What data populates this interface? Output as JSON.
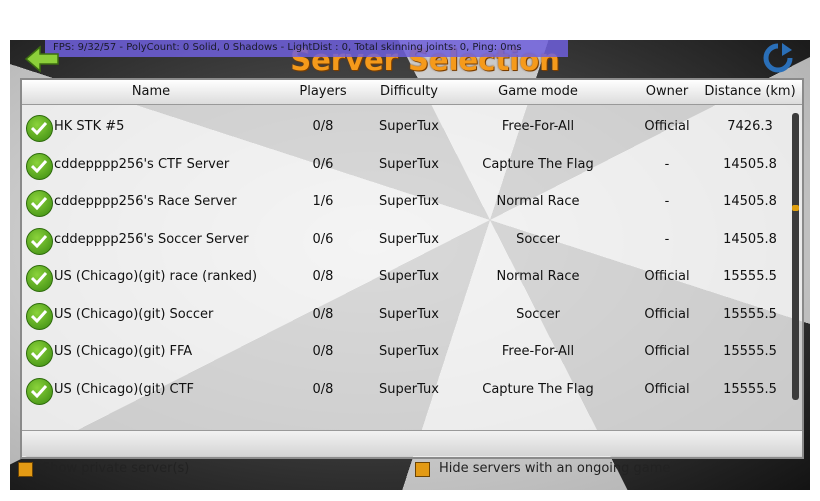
{
  "debug_bar": "FPS: 9/32/57  - PolyCount: 0 Solid, 0 Shadows - LightDist : 0, Total skinning joints: 0, Ping: 0ms",
  "title": "Server Selection",
  "colors": {
    "title": "#f59a1b",
    "debug_bar": "#6e5fdc",
    "checkbox": "#e39a14"
  },
  "columns": [
    "Name",
    "Players",
    "Difficulty",
    "Game mode",
    "Owner",
    "Distance (km)"
  ],
  "servers": [
    {
      "name": "HK STK #5",
      "players": "0/8",
      "difficulty": "SuperTux",
      "mode": "Free-For-All",
      "owner": "Official",
      "distance": "7426.3"
    },
    {
      "name": "cddepppp256's CTF Server",
      "players": "0/6",
      "difficulty": "SuperTux",
      "mode": "Capture The Flag",
      "owner": "-",
      "distance": "14505.8"
    },
    {
      "name": "cddepppp256's Race Server",
      "players": "1/6",
      "difficulty": "SuperTux",
      "mode": "Normal Race",
      "owner": "-",
      "distance": "14505.8"
    },
    {
      "name": "cddepppp256's Soccer Server",
      "players": "0/6",
      "difficulty": "SuperTux",
      "mode": "Soccer",
      "owner": "-",
      "distance": "14505.8"
    },
    {
      "name": "US (Chicago)(git) race (ranked)",
      "players": "0/8",
      "difficulty": "SuperTux",
      "mode": "Normal Race",
      "owner": "Official",
      "distance": "15555.5"
    },
    {
      "name": "US (Chicago)(git) Soccer",
      "players": "0/8",
      "difficulty": "SuperTux",
      "mode": "Soccer",
      "owner": "Official",
      "distance": "15555.5"
    },
    {
      "name": "US (Chicago)(git) FFA",
      "players": "0/8",
      "difficulty": "SuperTux",
      "mode": "Free-For-All",
      "owner": "Official",
      "distance": "15555.5"
    },
    {
      "name": "US (Chicago)(git) CTF",
      "players": "0/8",
      "difficulty": "SuperTux",
      "mode": "Capture The Flag",
      "owner": "Official",
      "distance": "15555.5"
    }
  ],
  "options": {
    "show_private": "Show private server(s)",
    "hide_ongoing": "Hide servers with an ongoing game"
  }
}
